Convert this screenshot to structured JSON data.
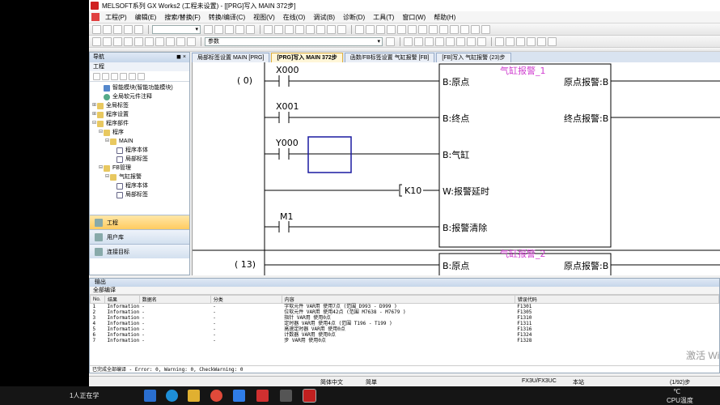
{
  "window": {
    "title": "MELSOFT系列 GX Works2 (工程未设置) - [[PRG]写入 MAIN 372步]"
  },
  "menu": [
    "工程(P)",
    "编辑(E)",
    "搜索/替换(F)",
    "转换/编译(C)",
    "视图(V)",
    "在线(O)",
    "调试(B)",
    "诊断(D)",
    "工具(T)",
    "窗口(W)",
    "帮助(H)"
  ],
  "toolbar": {
    "param_select": "参数"
  },
  "nav": {
    "title": "导航",
    "pin": "◼ ×",
    "section": "工程",
    "tree": [
      {
        "label": "智能模块(智能功能模块)",
        "level": 1,
        "icon": "blue",
        "expander": ""
      },
      {
        "label": "全局软元件注释",
        "level": 1,
        "icon": "gear",
        "expander": ""
      },
      {
        "label": "全局标签",
        "level": 0,
        "icon": "folder",
        "expander": "⊞"
      },
      {
        "label": "程序设置",
        "level": 0,
        "icon": "folder",
        "expander": "⊞"
      },
      {
        "label": "程序部件",
        "level": 0,
        "icon": "folder",
        "expander": "⊟"
      },
      {
        "label": "程序",
        "level": 1,
        "icon": "folder",
        "expander": "⊟"
      },
      {
        "label": "MAIN",
        "level": 2,
        "icon": "folder",
        "expander": "⊟"
      },
      {
        "label": "程序本体",
        "level": 3,
        "icon": "doc",
        "expander": ""
      },
      {
        "label": "局部标签",
        "level": 3,
        "icon": "doc",
        "expander": ""
      },
      {
        "label": "FB管理",
        "level": 1,
        "icon": "folder",
        "expander": "⊟"
      },
      {
        "label": "气缸报警",
        "level": 2,
        "icon": "folder",
        "expander": "⊟"
      },
      {
        "label": "程序本体",
        "level": 3,
        "icon": "doc",
        "expander": ""
      },
      {
        "label": "局部标签",
        "level": 3,
        "icon": "doc",
        "expander": ""
      }
    ],
    "tabs": [
      "工程",
      "用户库",
      "连接目标"
    ]
  },
  "editor_tabs": [
    "局部标签设置 MAIN [PRG]",
    "[PRG]写入 MAIN 372步",
    "函数/FB标签设置 气缸报警 [FB]",
    "[FB]写入 气缸报警 (23)步"
  ],
  "ladder": {
    "step1": "(      0)",
    "step2": "(     13)",
    "contacts": [
      "X000",
      "X001",
      "Y000",
      "M1"
    ],
    "k_value": "K10",
    "fb1": {
      "name": "气缸报警_1",
      "inputs": [
        "B:原点",
        "B:终点",
        "B:气缸",
        "W:报警延时",
        "B:报警清除"
      ],
      "outputs": [
        "原点报警:B",
        "终点报警:B"
      ]
    },
    "fb2": {
      "name": "气缸报警_2",
      "input": "B:原点",
      "output": "原点报警:B"
    }
  },
  "output": {
    "title": "输出",
    "subtitle": "全部编译",
    "columns": [
      "No.",
      "结果",
      "数据名",
      "分类",
      "内容",
      "错误代码"
    ],
    "rows": [
      [
        "1",
        "Information",
        "-",
        "-",
        "字软元件 VAR用 使用7点 (范围 D993 - D999 )",
        "F1301"
      ],
      [
        "2",
        "Information",
        "-",
        "-",
        "位软元件 VAR用 使用42点 (范围 M7638 - M7679 )",
        "F1305"
      ],
      [
        "3",
        "Information",
        "-",
        "-",
        "指针 VAR用 使用0点",
        "F1310"
      ],
      [
        "4",
        "Information",
        "-",
        "-",
        "定时器 VAR用 使用4点 (范围 T196 - T199 )",
        "F1311"
      ],
      [
        "5",
        "Information",
        "-",
        "-",
        "高速定时器 VAR用 使用0点",
        "F1316"
      ],
      [
        "6",
        "Information",
        "-",
        "-",
        "计数器 VAR用 使用0点",
        "F1324"
      ],
      [
        "7",
        "Information",
        "-",
        "-",
        "步 VAR用 使用0点",
        "F1328"
      ]
    ],
    "footer": "已完成全部编译 - Error: 0, Warning: 0, CheckWarning: 0"
  },
  "status": {
    "lang": "简体中文",
    "mode": "简単",
    "cpu": "FX3U/FX3UC",
    "station": "本站",
    "steps": "(1/92)步"
  },
  "watermark": "激活 Wi",
  "taskbar": {
    "left_text": "1人正在学",
    "temp": "℃",
    "cpu": "CPU温度"
  }
}
